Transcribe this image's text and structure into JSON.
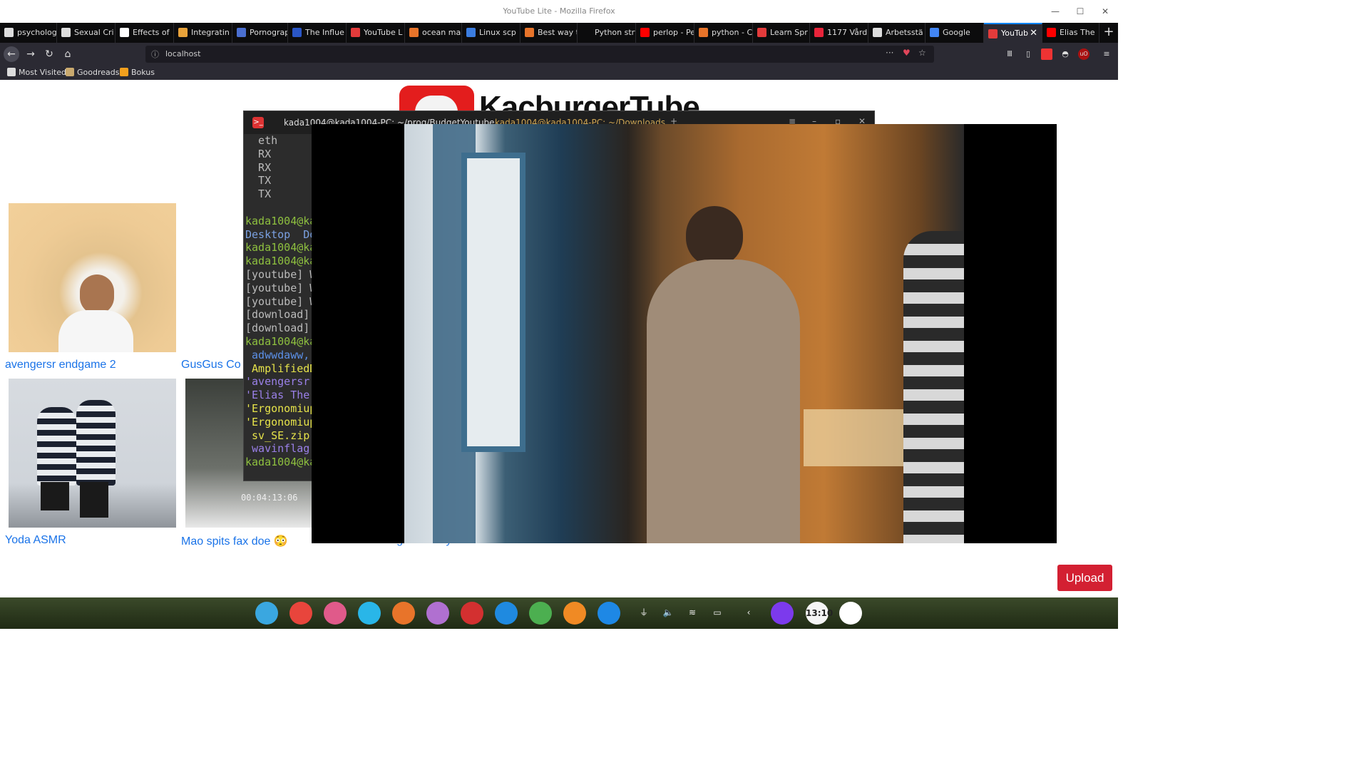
{
  "window": {
    "title": "YouTube Lite - Mozilla Firefox",
    "minimize": "—",
    "maximize": "☐",
    "close": "✕"
  },
  "tabs": [
    {
      "label": "psycholog",
      "color": "#dddddd"
    },
    {
      "label": "Sexual Cri",
      "color": "#dddddd"
    },
    {
      "label": "Effects of",
      "color": "#ffffff"
    },
    {
      "label": "Integratin",
      "color": "#e8a23a"
    },
    {
      "label": "Pornograp",
      "color": "#4a6fd0"
    },
    {
      "label": "The Influe",
      "color": "#2a56c6"
    },
    {
      "label": "YouTube L",
      "color": "#e33b3b"
    },
    {
      "label": "ocean ma",
      "color": "#e8742a"
    },
    {
      "label": "Linux scp",
      "color": "#3b7de0"
    },
    {
      "label": "Best way t",
      "color": "#e8742a"
    },
    {
      "label": "Python strftim",
      "color": "#0c0c0d"
    },
    {
      "label": "perlop - Pe",
      "color": "#ff0000"
    },
    {
      "label": "python - C",
      "color": "#e8742a"
    },
    {
      "label": "Learn Spr",
      "color": "#e33b3b"
    },
    {
      "label": "1177 Vård",
      "color": "#e8243a"
    },
    {
      "label": "Arbetsstä",
      "color": "#dddddd"
    },
    {
      "label": "Google",
      "color": "#4285f4"
    },
    {
      "label": "YouTub",
      "color": "#e33b3b"
    },
    {
      "label": "Elias The",
      "color": "#ff0000"
    }
  ],
  "tab_close": "✕",
  "new_tab": "+",
  "nav": {
    "back": "←",
    "forward": "→",
    "reload": "↻",
    "home": "⌂",
    "url": "localhost",
    "page_actions": "···"
  },
  "bookmarks": [
    {
      "label": "Most Visited",
      "color": "#dddddd"
    },
    {
      "label": "Goodreads",
      "color": "#c9a96e"
    },
    {
      "label": "Bokus",
      "color": "#f2a01e"
    }
  ],
  "site": {
    "logo_text": "KacburgerTube",
    "upload_label": "Upload"
  },
  "videos": [
    {
      "title": "avengersr endgame 2"
    },
    {
      "title": "GusGus Co"
    },
    {
      "title": "Yoda ASMR"
    },
    {
      "title": "Mao spits fax doe 😳"
    },
    {
      "title": "Ahmed goes crazy"
    }
  ],
  "thumb_timestamp": "00:04:13:06",
  "terminal": {
    "tab1": "kada1004@kada1004-PC: ~/prog/BudgetYoutube",
    "tab2": "kada1004@kada1004-PC: ~/Downloads",
    "add": "+",
    "menu": "≡",
    "lines": [
      {
        "text": "  eth",
        "cls": "c-white"
      },
      {
        "text": "  RX",
        "cls": "c-white"
      },
      {
        "text": "  RX",
        "cls": "c-white"
      },
      {
        "text": "  TX",
        "cls": "c-white"
      },
      {
        "text": "  TX",
        "cls": "c-white"
      },
      {
        "text": "",
        "cls": "c-white"
      },
      {
        "text": "kada1004@ka",
        "cls": "c-green"
      },
      {
        "text": "Desktop  Do",
        "cls": "c-blue"
      },
      {
        "text": "kada1004@ka",
        "cls": "c-green"
      },
      {
        "text": "kada1004@ka",
        "cls": "c-green"
      },
      {
        "text": "[youtube] W",
        "cls": "c-white"
      },
      {
        "text": "[youtube] W",
        "cls": "c-white"
      },
      {
        "text": "[youtube] W",
        "cls": "c-white"
      },
      {
        "text": "[download]",
        "cls": "c-white"
      },
      {
        "text": "[download]",
        "cls": "c-white"
      },
      {
        "text": "kada1004@ka",
        "cls": "c-green"
      },
      {
        "text": " adwwdaww,",
        "cls": "c-lblue"
      },
      {
        "text": " AmplifiedD",
        "cls": "c-yellow"
      },
      {
        "text": "'avengersr",
        "cls": "c-purple"
      },
      {
        "text": "'Elias The",
        "cls": "c-purple"
      },
      {
        "text": "'Ergonomiup",
        "cls": "c-yellow"
      },
      {
        "text": "'Ergonomiup",
        "cls": "c-yellow"
      },
      {
        "text": " sv_SE.zip",
        "cls": "c-yellow"
      },
      {
        "text": " wavinflag.",
        "cls": "c-purple"
      },
      {
        "text": "kada1004@ka",
        "cls": "c-green"
      }
    ]
  },
  "taskbar": {
    "dock": [
      {
        "name": "launcher-icon",
        "color": "#3aa7e0"
      },
      {
        "name": "grid-apps-icon",
        "color": "#e8453c"
      },
      {
        "name": "lollypop-icon",
        "color": "#e05a8a"
      },
      {
        "name": "files-icon",
        "color": "#29b6e8"
      },
      {
        "name": "browser-icon",
        "color": "#e8742a"
      },
      {
        "name": "paint-icon",
        "color": "#b070d0"
      },
      {
        "name": "terminal-icon",
        "color": "#d33030"
      },
      {
        "name": "skype-icon",
        "color": "#1f8ae0"
      },
      {
        "name": "atom-icon",
        "color": "#4caf50"
      },
      {
        "name": "settings-icon",
        "color": "#f08a24"
      },
      {
        "name": "media-player-icon",
        "color": "#1e88e5"
      }
    ],
    "tray": [
      "⏚",
      "🔈",
      "≋",
      "▭",
      "‹"
    ],
    "power_color": "#7c3aed",
    "clock": "13:10",
    "trash_color": "#ffffff"
  }
}
